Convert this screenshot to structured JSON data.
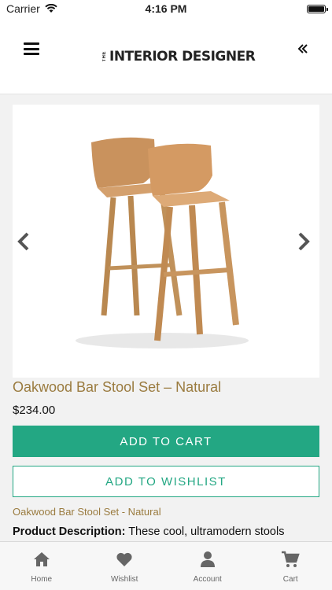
{
  "status_bar": {
    "carrier": "Carrier",
    "time": "4:16 PM"
  },
  "header": {
    "logo_prefix": "THE",
    "logo_text": "INTERIOR DESIGNER",
    "menu_icon": "hamburger-icon",
    "collapse_icon": "double-chevron-left-icon"
  },
  "product": {
    "title": "Oakwood Bar Stool Set – Natural",
    "price": "$234.00",
    "add_to_cart": "ADD TO CART",
    "add_to_wishlist": "ADD TO WISHLIST",
    "subtitle": "Oakwood Bar Stool Set - Natural",
    "description_label": "Product Description:",
    "description_text": "These cool, ultramodern stools"
  },
  "tabs": [
    {
      "label": "Home",
      "icon": "home-icon"
    },
    {
      "label": "Wishlist",
      "icon": "heart-icon"
    },
    {
      "label": "Account",
      "icon": "user-icon"
    },
    {
      "label": "Cart",
      "icon": "cart-icon"
    }
  ],
  "colors": {
    "accent": "#23a783",
    "title": "#9a7b3f",
    "icon": "#666666"
  }
}
